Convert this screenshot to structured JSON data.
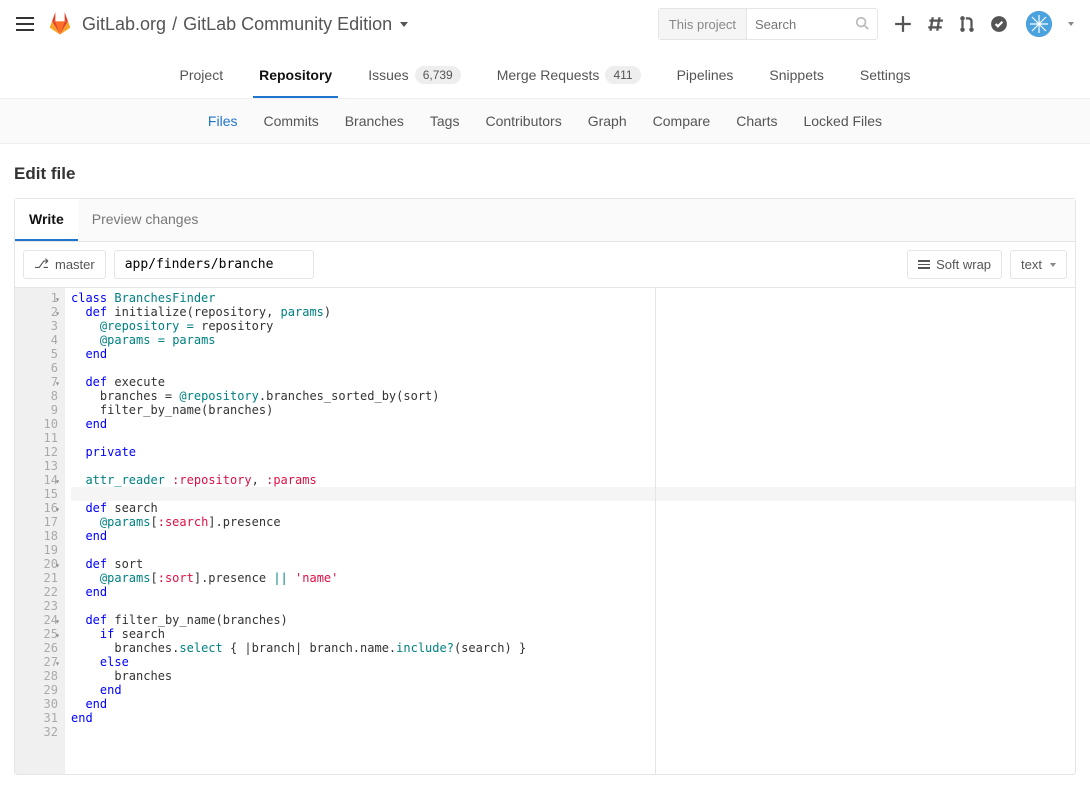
{
  "header": {
    "org": "GitLab.org",
    "project": "GitLab Community Edition"
  },
  "search": {
    "scope": "This project",
    "placeholder": "Search"
  },
  "nav": [
    {
      "label": "Project"
    },
    {
      "label": "Repository",
      "active": true
    },
    {
      "label": "Issues",
      "badge": "6,739"
    },
    {
      "label": "Merge Requests",
      "badge": "411"
    },
    {
      "label": "Pipelines"
    },
    {
      "label": "Snippets"
    },
    {
      "label": "Settings"
    }
  ],
  "subnav": [
    {
      "label": "Files",
      "active": true
    },
    {
      "label": "Commits"
    },
    {
      "label": "Branches"
    },
    {
      "label": "Tags"
    },
    {
      "label": "Contributors"
    },
    {
      "label": "Graph"
    },
    {
      "label": "Compare"
    },
    {
      "label": "Charts"
    },
    {
      "label": "Locked Files"
    }
  ],
  "page": {
    "title": "Edit file"
  },
  "tabs": {
    "write": "Write",
    "preview": "Preview changes"
  },
  "toolbar": {
    "branch": "master",
    "path": "app/finders/branche",
    "softwrap": "Soft wrap",
    "lang": "text"
  },
  "code": {
    "lines": 32,
    "fold_lines": [
      1,
      2,
      7,
      14,
      16,
      20,
      24,
      25,
      27
    ],
    "cursor_line": 15,
    "tokens": [
      [
        [
          "kw",
          "class"
        ],
        [
          "sp",
          " "
        ],
        [
          "cls",
          "BranchesFinder"
        ]
      ],
      [
        [
          "sp",
          "  "
        ],
        [
          "kw",
          "def"
        ],
        [
          "sp",
          " "
        ],
        [
          "ident",
          "initialize(repository, "
        ],
        [
          "cls",
          "params"
        ],
        [
          "ident",
          ")"
        ]
      ],
      [
        [
          "sp",
          "    "
        ],
        [
          "ivar",
          "@repository"
        ],
        [
          "sp",
          " "
        ],
        [
          "cls",
          "="
        ],
        [
          "sp",
          " "
        ],
        [
          "ident",
          "repository"
        ]
      ],
      [
        [
          "sp",
          "    "
        ],
        [
          "ivar",
          "@params"
        ],
        [
          "sp",
          " "
        ],
        [
          "cls",
          "="
        ],
        [
          "sp",
          " "
        ],
        [
          "cls",
          "params"
        ]
      ],
      [
        [
          "sp",
          "  "
        ],
        [
          "kw",
          "end"
        ]
      ],
      [],
      [
        [
          "sp",
          "  "
        ],
        [
          "kw",
          "def"
        ],
        [
          "sp",
          " "
        ],
        [
          "ident",
          "execute"
        ]
      ],
      [
        [
          "sp",
          "    "
        ],
        [
          "ident",
          "branches = "
        ],
        [
          "ivar",
          "@repository"
        ],
        [
          "ident",
          ".branches_sorted_by(sort)"
        ]
      ],
      [
        [
          "sp",
          "    "
        ],
        [
          "ident",
          "filter_by_name(branches)"
        ]
      ],
      [
        [
          "sp",
          "  "
        ],
        [
          "kw",
          "end"
        ]
      ],
      [],
      [
        [
          "sp",
          "  "
        ],
        [
          "kw",
          "private"
        ]
      ],
      [],
      [
        [
          "sp",
          "  "
        ],
        [
          "cls",
          "attr_reader"
        ],
        [
          "sp",
          " "
        ],
        [
          "sym",
          ":repository"
        ],
        [
          "ident",
          ", "
        ],
        [
          "sym",
          ":params"
        ]
      ],
      [],
      [
        [
          "sp",
          "  "
        ],
        [
          "kw",
          "def"
        ],
        [
          "sp",
          " "
        ],
        [
          "ident",
          "search"
        ]
      ],
      [
        [
          "sp",
          "    "
        ],
        [
          "ivar",
          "@params"
        ],
        [
          "ident",
          "["
        ],
        [
          "sym",
          ":search"
        ],
        [
          "ident",
          "].presence"
        ]
      ],
      [
        [
          "sp",
          "  "
        ],
        [
          "kw",
          "end"
        ]
      ],
      [],
      [
        [
          "sp",
          "  "
        ],
        [
          "kw",
          "def"
        ],
        [
          "sp",
          " "
        ],
        [
          "ident",
          "sort"
        ]
      ],
      [
        [
          "sp",
          "    "
        ],
        [
          "ivar",
          "@params"
        ],
        [
          "ident",
          "["
        ],
        [
          "sym",
          ":sort"
        ],
        [
          "ident",
          "].presence "
        ],
        [
          "cls",
          "||"
        ],
        [
          "sp",
          " "
        ],
        [
          "sym",
          "'name'"
        ]
      ],
      [
        [
          "sp",
          "  "
        ],
        [
          "kw",
          "end"
        ]
      ],
      [],
      [
        [
          "sp",
          "  "
        ],
        [
          "kw",
          "def"
        ],
        [
          "sp",
          " "
        ],
        [
          "ident",
          "filter_by_name(branches)"
        ]
      ],
      [
        [
          "sp",
          "    "
        ],
        [
          "kw",
          "if"
        ],
        [
          "sp",
          " "
        ],
        [
          "ident",
          "search"
        ]
      ],
      [
        [
          "sp",
          "      "
        ],
        [
          "ident",
          "branches."
        ],
        [
          "cls",
          "select"
        ],
        [
          "ident",
          " { |branch| branch.name."
        ],
        [
          "cls",
          "include?"
        ],
        [
          "ident",
          "(search) }"
        ]
      ],
      [
        [
          "sp",
          "    "
        ],
        [
          "kw",
          "else"
        ]
      ],
      [
        [
          "sp",
          "      "
        ],
        [
          "ident",
          "branches"
        ]
      ],
      [
        [
          "sp",
          "    "
        ],
        [
          "kw",
          "end"
        ]
      ],
      [
        [
          "sp",
          "  "
        ],
        [
          "kw",
          "end"
        ]
      ],
      [
        [
          "kw",
          "end"
        ]
      ],
      []
    ]
  }
}
